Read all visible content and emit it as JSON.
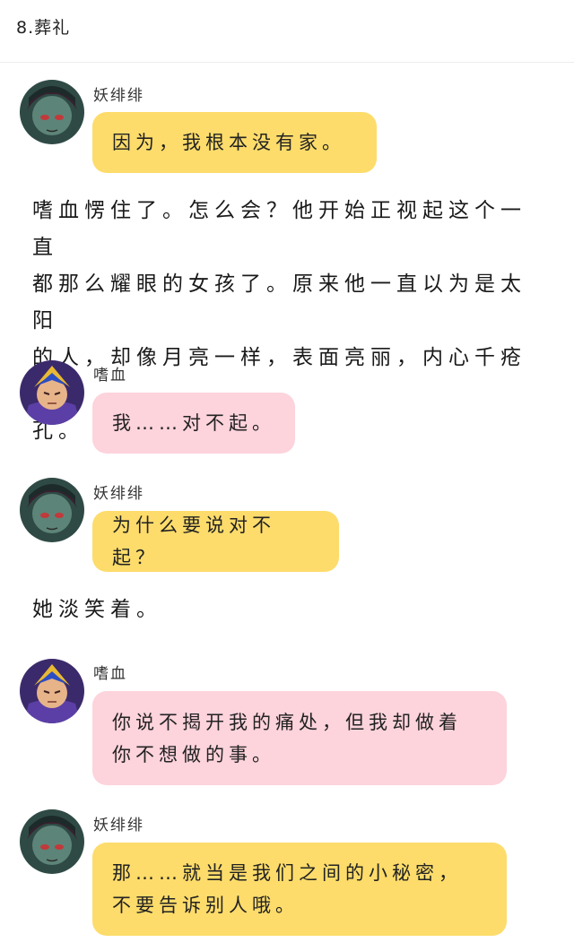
{
  "header": {
    "title": "8.葬礼"
  },
  "messages": [
    {
      "speaker": "妖绯绯",
      "text": "因为，我根本没有家。"
    },
    {
      "speaker": "嗜血",
      "text": "我……对不起。"
    },
    {
      "speaker": "妖绯绯",
      "text": "为什么要说对不起？"
    },
    {
      "speaker": "嗜血",
      "line1": "你说不揭开我的痛处，但我却做着",
      "line2": "你不想做的事。"
    },
    {
      "speaker": "妖绯绯",
      "line1": "那……就当是我们之间的小秘密，",
      "line2": "不要告诉别人哦。"
    }
  ],
  "narrations": [
    {
      "line1": "嗜血愣住了。怎么会？他开始正视起这个一直",
      "line2": "都那么耀眼的女孩了。原来他一直以为是太阳",
      "line3": "的人，却像月亮一样，表面亮丽，内心千疮百",
      "line4": "孔。"
    },
    {
      "line1": "她淡笑着。"
    }
  ],
  "colors": {
    "yellow_bubble": "#fddc6b",
    "pink_bubble": "#fdd3dc"
  },
  "icons": {
    "yaofeifei_avatar": "green-skinned-character-avatar-icon",
    "shixue_avatar": "purple-armored-character-avatar-icon"
  }
}
